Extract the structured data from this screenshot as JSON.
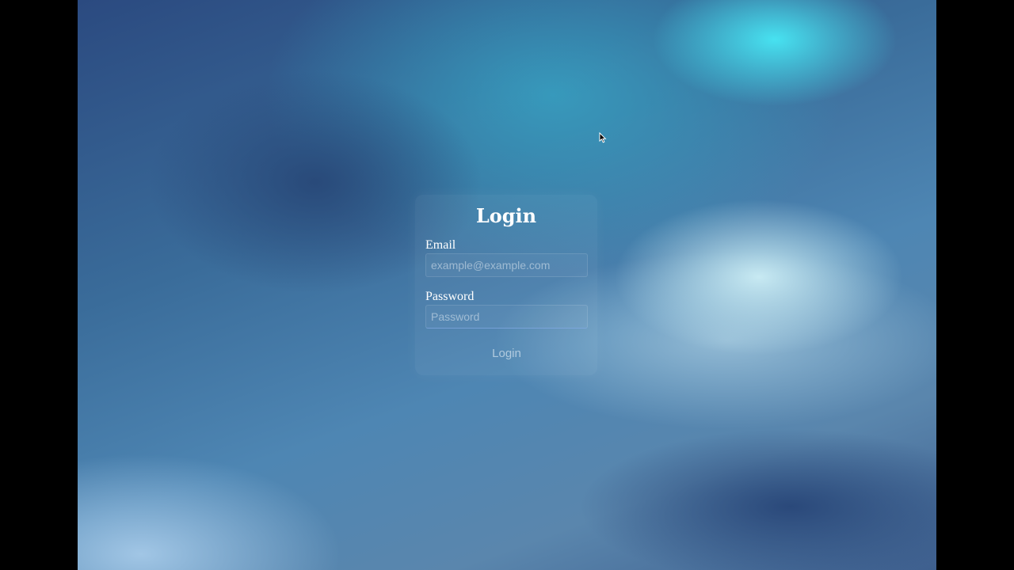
{
  "login_form": {
    "title": "Login",
    "email": {
      "label": "Email",
      "value": "",
      "placeholder": "example@example.com"
    },
    "password": {
      "label": "Password",
      "value": "",
      "placeholder": "Password"
    },
    "submit_label": "Login"
  },
  "icons": {
    "cursor": "mouse-pointer-icon"
  }
}
